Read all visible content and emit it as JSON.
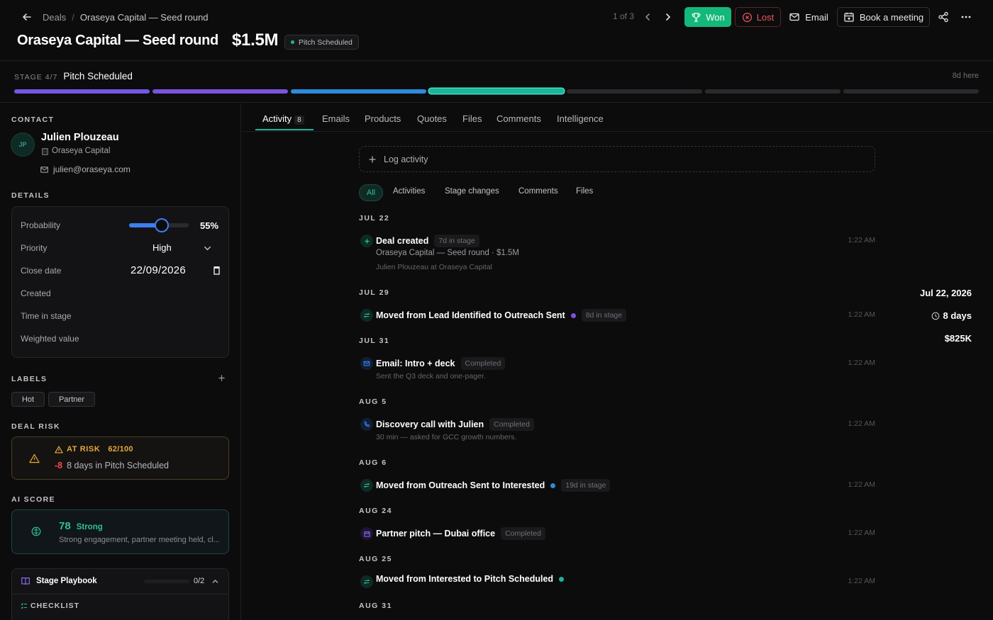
{
  "breadcrumb": {
    "root": "Deals",
    "separator": "/",
    "current": "Oraseya Capital — Seed round"
  },
  "header": {
    "title": "Oraseya Capital — Seed round",
    "amount": "$1.5M",
    "stage_chip": "Pitch Scheduled"
  },
  "pager": {
    "text": "1 of 3"
  },
  "actions": {
    "won": "Won",
    "lost": "Lost",
    "email": "Email",
    "book": "Book a meeting"
  },
  "stage": {
    "prefix": "STAGE 4/7",
    "name": "Pitch Scheduled",
    "time_here": "8d here",
    "progress": {
      "current": 4,
      "total": 7
    },
    "segment_colors": [
      "#7655e6",
      "#7d52e0",
      "#2c8bdd",
      "#1eb39b"
    ]
  },
  "contact": {
    "section": "CONTACT",
    "initials": "JP",
    "name": "Julien Plouzeau",
    "company": "Oraseya Capital",
    "email": "julien@oraseya.com"
  },
  "details": {
    "section": "DETAILS",
    "probability": {
      "label": "Probability",
      "value": "55%",
      "fraction": 0.55
    },
    "priority": {
      "label": "Priority",
      "value": "High"
    },
    "close_date": {
      "label": "Close date",
      "value": "22/09/2026"
    },
    "created": {
      "label": "Created",
      "value": "Jul 22, 2026"
    },
    "time_in_stage": {
      "label": "Time in stage",
      "value": "8 days"
    },
    "weighted": {
      "label": "Weighted value",
      "value": "$825K"
    }
  },
  "labels": {
    "section": "LABELS",
    "items": [
      "Hot",
      "Partner"
    ]
  },
  "risk": {
    "section": "DEAL RISK",
    "status": "AT RISK",
    "score": "62/100",
    "delta": "-8",
    "reason": "8 days in Pitch Scheduled"
  },
  "ai": {
    "section": "AI SCORE",
    "score": "78",
    "grade": "Strong",
    "summary": "Strong engagement, partner meeting held, cl..."
  },
  "playbook": {
    "title": "Stage Playbook",
    "count": "0/2",
    "checklist": "CHECKLIST"
  },
  "tabs": [
    {
      "label": "Activity",
      "count": "8"
    },
    {
      "label": "Emails"
    },
    {
      "label": "Products"
    },
    {
      "label": "Quotes"
    },
    {
      "label": "Files"
    },
    {
      "label": "Comments"
    },
    {
      "label": "Intelligence"
    }
  ],
  "log_activity": "Log activity",
  "filters": [
    "All",
    "Activities",
    "Stage changes",
    "Comments",
    "Files"
  ],
  "timeline": [
    {
      "date": "JUL 22",
      "title": "Deal created",
      "chip": "7d in stage",
      "sub": "Oraseya Capital — Seed round · $1.5M",
      "sub2": "Julien Plouzeau at Oraseya Capital",
      "time": "1:22 AM"
    },
    {
      "date": "JUL 29",
      "title": "Moved from Lead Identified to Outreach Sent",
      "chip": "8d in stage",
      "time": "1:22 AM",
      "dot": "#7d52e0"
    },
    {
      "date": "JUL 31",
      "title": "Email: Intro + deck",
      "chip": "Completed",
      "sub2": "Sent the Q3 deck and one-pager.",
      "time": "1:22 AM"
    },
    {
      "date": "AUG 5",
      "title": "Discovery call with Julien",
      "chip": "Completed",
      "sub2": "30 min — asked for GCC growth numbers.",
      "time": "1:22 AM"
    },
    {
      "date": "AUG 6",
      "title": "Moved from Outreach Sent to Interested",
      "chip": "19d in stage",
      "time": "1:22 AM",
      "dot": "#2c8bdd"
    },
    {
      "date": "AUG 24",
      "title": "Partner pitch — Dubai office",
      "chip": "Completed",
      "time": "1:22 AM"
    },
    {
      "date": "AUG 25",
      "title": "Moved from Interested to Pitch Scheduled",
      "time": "1:22 AM",
      "dot": "#1eb39b"
    },
    {
      "date": "AUG 31"
    }
  ]
}
